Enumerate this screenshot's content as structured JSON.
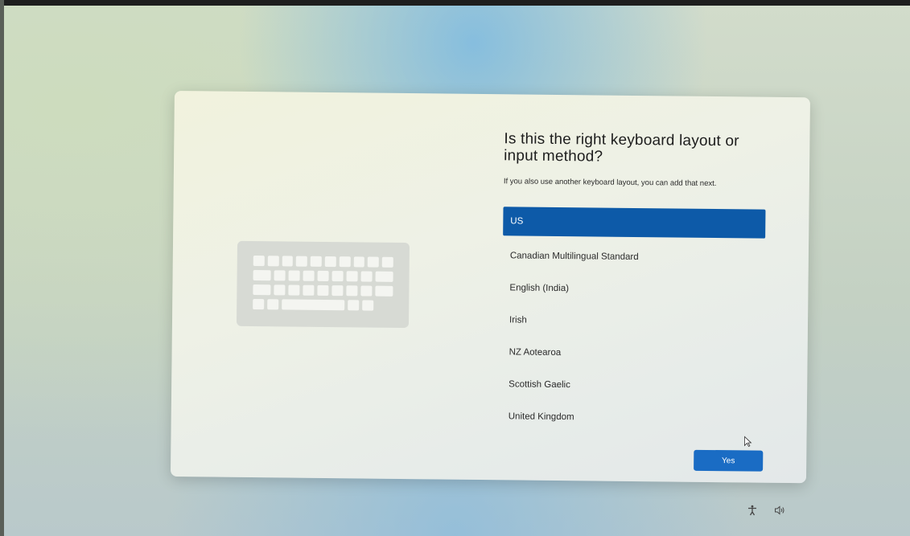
{
  "dialog": {
    "title": "Is this the right keyboard layout or input method?",
    "subtitle": "If you also use another keyboard layout, you can add that next.",
    "layouts": [
      {
        "label": "US",
        "selected": true
      },
      {
        "label": "Canadian Multilingual Standard",
        "selected": false
      },
      {
        "label": "English (India)",
        "selected": false
      },
      {
        "label": "Irish",
        "selected": false
      },
      {
        "label": "NZ Aotearoa",
        "selected": false
      },
      {
        "label": "Scottish Gaelic",
        "selected": false
      },
      {
        "label": "United Kingdom",
        "selected": false
      }
    ],
    "confirm_label": "Yes",
    "illustration": "keyboard-icon"
  },
  "tray": {
    "icons": [
      "accessibility-icon",
      "volume-icon"
    ]
  },
  "colors": {
    "accent": "#0d5aa8",
    "button": "#1a6cc4"
  }
}
